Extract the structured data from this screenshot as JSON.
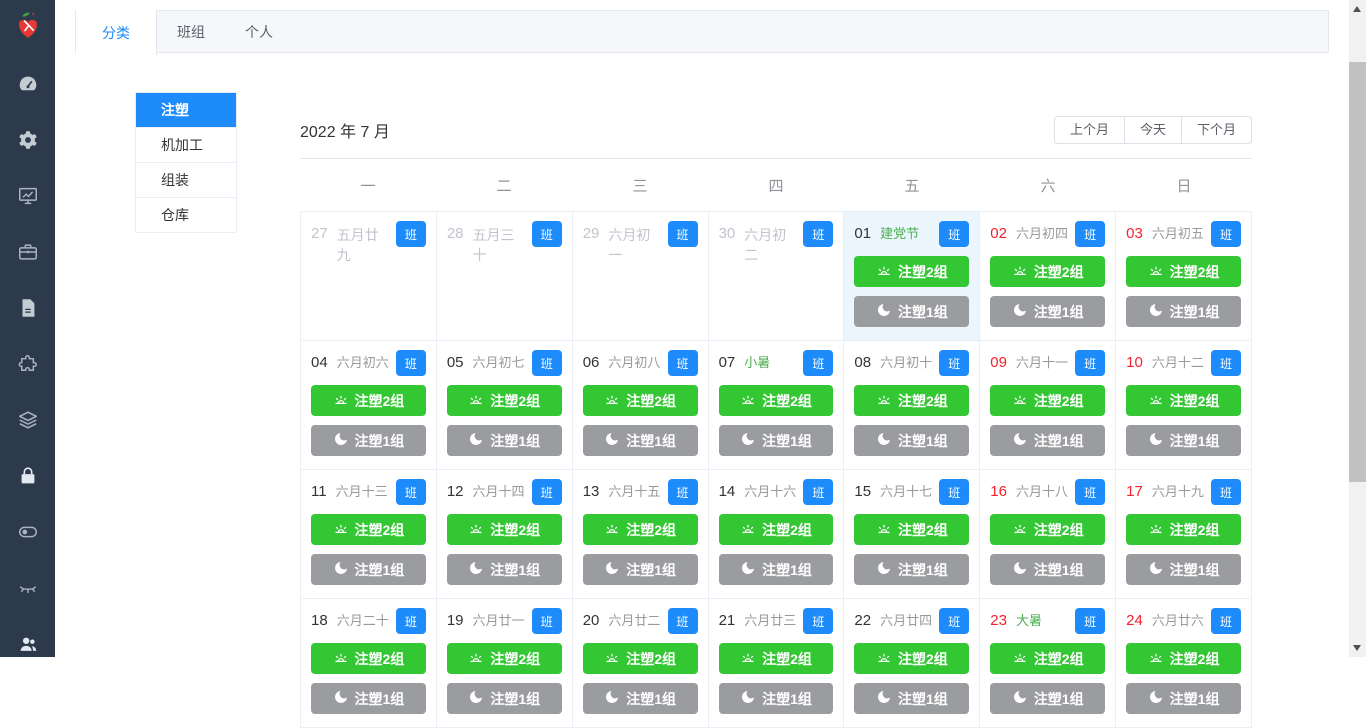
{
  "colors": {
    "sidebar_bg": "#2d3a4b",
    "accent_blue": "#1d8cfa",
    "day_shift_green": "#34c734",
    "night_shift_gray": "#9b9ca0",
    "holiday_green": "#4caf50",
    "weekend_red": "#f5212d",
    "muted_gray": "#c0c4cc",
    "today_cell_bg": "#ecf6fe"
  },
  "sidebar": {
    "logo_icon": "strawberry-logo",
    "icons": [
      "dashboard",
      "gear",
      "monitor-chart",
      "briefcase",
      "document",
      "puzzle",
      "layers",
      "lock",
      "toggle",
      "eye-closed",
      "users"
    ]
  },
  "tabs": {
    "items": [
      {
        "key": "category",
        "label": "分类",
        "active": true
      },
      {
        "key": "team",
        "label": "班组",
        "active": false
      },
      {
        "key": "personal",
        "label": "个人",
        "active": false
      }
    ]
  },
  "categories": {
    "items": [
      {
        "key": "zhusu",
        "label": "注塑",
        "active": true
      },
      {
        "key": "jijiagong",
        "label": "机加工",
        "active": false
      },
      {
        "key": "zuzhuang",
        "label": "组装",
        "active": false
      },
      {
        "key": "cangku",
        "label": "仓库",
        "active": false
      }
    ]
  },
  "calendar": {
    "title": "2022 年 7 月",
    "nav": [
      {
        "key": "prev-month",
        "label": "上个月"
      },
      {
        "key": "today",
        "label": "今天"
      },
      {
        "key": "next-month",
        "label": "下个月"
      }
    ],
    "weekdays": [
      "一",
      "二",
      "三",
      "四",
      "五",
      "六",
      "日"
    ],
    "badge_label": "班",
    "day_shift_label": "注塑2组",
    "night_shift_label": "注塑1组",
    "cells": [
      {
        "day": "27",
        "lunar": "五月廿九",
        "type": "prev"
      },
      {
        "day": "28",
        "lunar": "五月三十",
        "type": "prev"
      },
      {
        "day": "29",
        "lunar": "六月初一",
        "type": "prev"
      },
      {
        "day": "30",
        "lunar": "六月初二",
        "type": "prev"
      },
      {
        "day": "01",
        "lunar": "建党节",
        "lunar_style": "holiday",
        "highlight": true
      },
      {
        "day": "02",
        "lunar": "六月初四",
        "num": "red"
      },
      {
        "day": "03",
        "lunar": "六月初五",
        "num": "red"
      },
      {
        "day": "04",
        "lunar": "六月初六"
      },
      {
        "day": "05",
        "lunar": "六月初七"
      },
      {
        "day": "06",
        "lunar": "六月初八"
      },
      {
        "day": "07",
        "lunar": "小暑",
        "lunar_style": "holiday"
      },
      {
        "day": "08",
        "lunar": "六月初十"
      },
      {
        "day": "09",
        "lunar": "六月十一",
        "num": "red"
      },
      {
        "day": "10",
        "lunar": "六月十二",
        "num": "red"
      },
      {
        "day": "11",
        "lunar": "六月十三"
      },
      {
        "day": "12",
        "lunar": "六月十四"
      },
      {
        "day": "13",
        "lunar": "六月十五"
      },
      {
        "day": "14",
        "lunar": "六月十六"
      },
      {
        "day": "15",
        "lunar": "六月十七"
      },
      {
        "day": "16",
        "lunar": "六月十八",
        "num": "red"
      },
      {
        "day": "17",
        "lunar": "六月十九",
        "num": "red"
      },
      {
        "day": "18",
        "lunar": "六月二十"
      },
      {
        "day": "19",
        "lunar": "六月廿一"
      },
      {
        "day": "20",
        "lunar": "六月廿二"
      },
      {
        "day": "21",
        "lunar": "六月廿三"
      },
      {
        "day": "22",
        "lunar": "六月廿四"
      },
      {
        "day": "23",
        "lunar": "大暑",
        "num": "red",
        "lunar_style": "holiday"
      },
      {
        "day": "24",
        "lunar": "六月廿六",
        "num": "red"
      }
    ]
  }
}
